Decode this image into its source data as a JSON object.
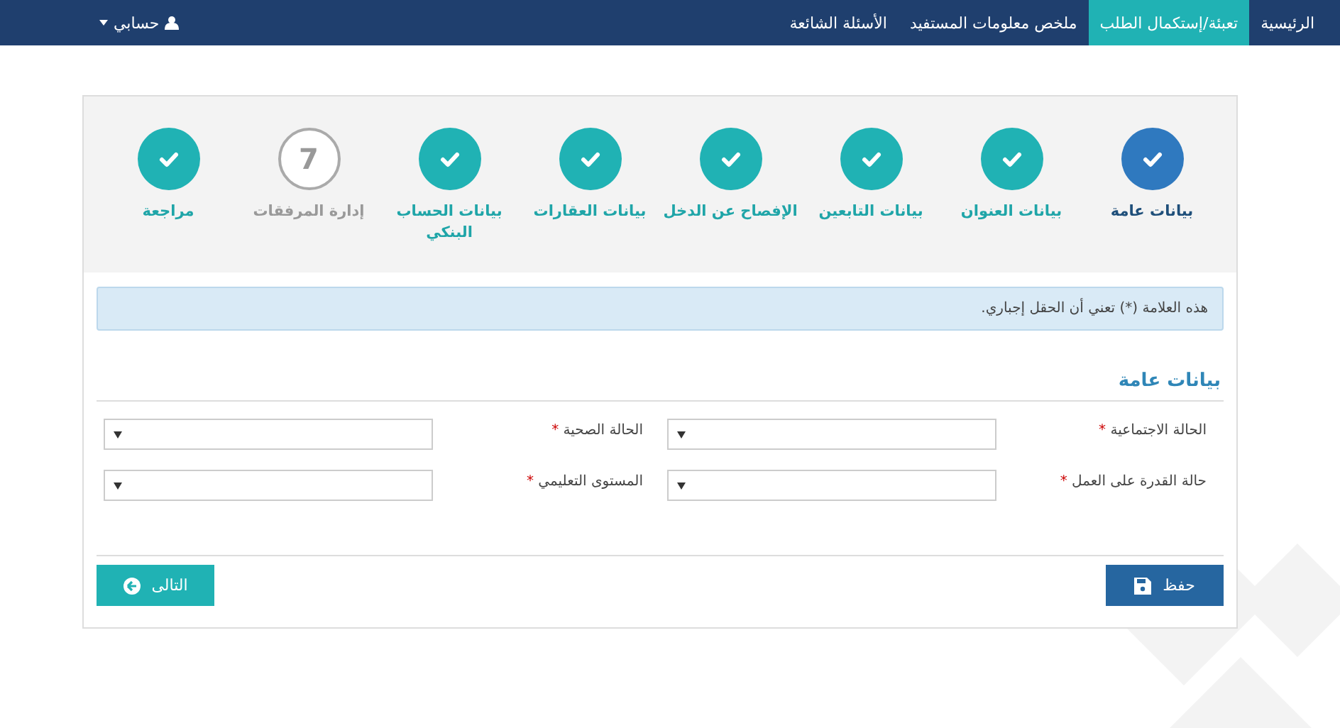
{
  "nav": {
    "items": [
      {
        "label": "الرئيسية",
        "selected": false
      },
      {
        "label": "تعبئة/إستكمال الطلب",
        "selected": true
      },
      {
        "label": "ملخص معلومات المستفيد",
        "selected": false
      },
      {
        "label": "الأسئلة الشائعة",
        "selected": false
      }
    ],
    "account": "حسابي"
  },
  "steps": [
    {
      "label": "بيانات عامة",
      "kind": "current"
    },
    {
      "label": "بيانات العنوان",
      "kind": "done"
    },
    {
      "label": "بيانات التابعين",
      "kind": "done"
    },
    {
      "label": "الإفصاح عن الدخل",
      "kind": "done"
    },
    {
      "label": "بيانات العقارات",
      "kind": "done"
    },
    {
      "label": "بيانات الحساب البنكي",
      "kind": "done"
    },
    {
      "label": "إدارة المرفقات",
      "kind": "pending",
      "number": "7"
    },
    {
      "label": "مراجعة",
      "kind": "done"
    }
  ],
  "notice": "هذه العلامة (*) تعني أن الحقل إجباري.",
  "section_title": "بيانات عامة",
  "fields": [
    {
      "label": "الحالة الاجتماعية",
      "mark": "*"
    },
    {
      "label": "الحالة الصحية",
      "mark": "*"
    },
    {
      "label": "حالة القدرة على العمل",
      "mark": "*"
    },
    {
      "label": "المستوى التعليمي",
      "mark": "*"
    }
  ],
  "buttons": {
    "save": "حفظ",
    "next": "التالى"
  }
}
